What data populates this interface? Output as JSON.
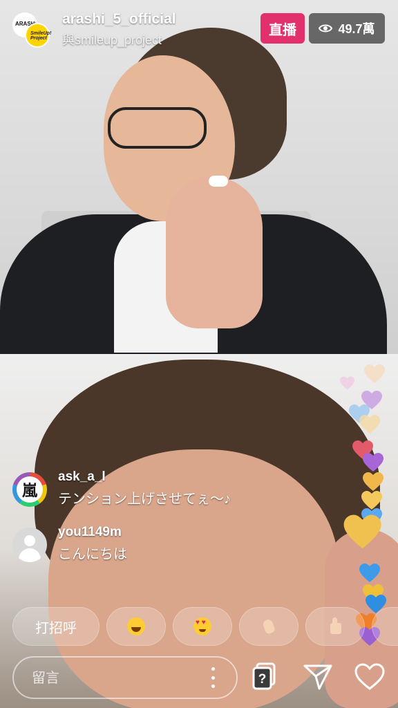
{
  "header": {
    "username": "arashi_5_official",
    "with_text": "與smileup_project",
    "main_avatar_text": "ARASHI",
    "co_avatar_text": "SmileUp! Project",
    "live_label": "直播",
    "viewers_count": "49.7萬"
  },
  "comments": [
    {
      "user": "ask_a_l",
      "text": "テンション上げさせてぇ〜♪",
      "avatar_glyph": "嵐"
    },
    {
      "user": "you1149m",
      "text": "こんにちは"
    }
  ],
  "quick_reactions": {
    "greet_label": "打招呼",
    "emojis": [
      "laughing-face",
      "heart-eyes-face",
      "waving-hand",
      "thumbs-up"
    ]
  },
  "bottom_bar": {
    "comment_placeholder": "留言"
  },
  "colors": {
    "live_badge": "#e1306c",
    "viewer_badge_bg": "rgba(0,0,0,0.55)"
  }
}
